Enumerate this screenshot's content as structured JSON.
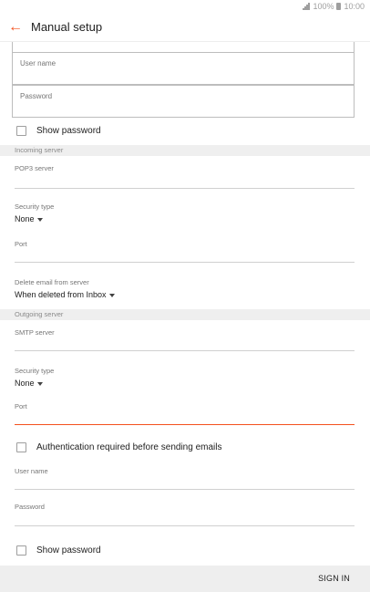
{
  "status_bar": {
    "battery_percent": "100%",
    "time": "10:00"
  },
  "app_bar": {
    "title": "Manual setup"
  },
  "account": {
    "user_name_label": "User name",
    "password_label": "Password",
    "show_password_label": "Show password"
  },
  "incoming": {
    "section_title": "Incoming server",
    "server_label": "POP3 server",
    "security_type_label": "Security type",
    "security_type_value": "None",
    "port_label": "Port",
    "delete_label": "Delete email from server",
    "delete_value": "When deleted from Inbox"
  },
  "outgoing": {
    "section_title": "Outgoing server",
    "server_label": "SMTP server",
    "security_type_label": "Security type",
    "security_type_value": "None",
    "port_label": "Port",
    "auth_label": "Authentication required before sending emails",
    "user_name_label": "User name",
    "password_label": "Password",
    "show_password_label": "Show password"
  },
  "bottom": {
    "sign_in_label": "SIGN IN"
  },
  "colors": {
    "accent": "#f4511e",
    "section_bg": "#efefef",
    "bottom_bar_bg": "#eeeeee"
  }
}
